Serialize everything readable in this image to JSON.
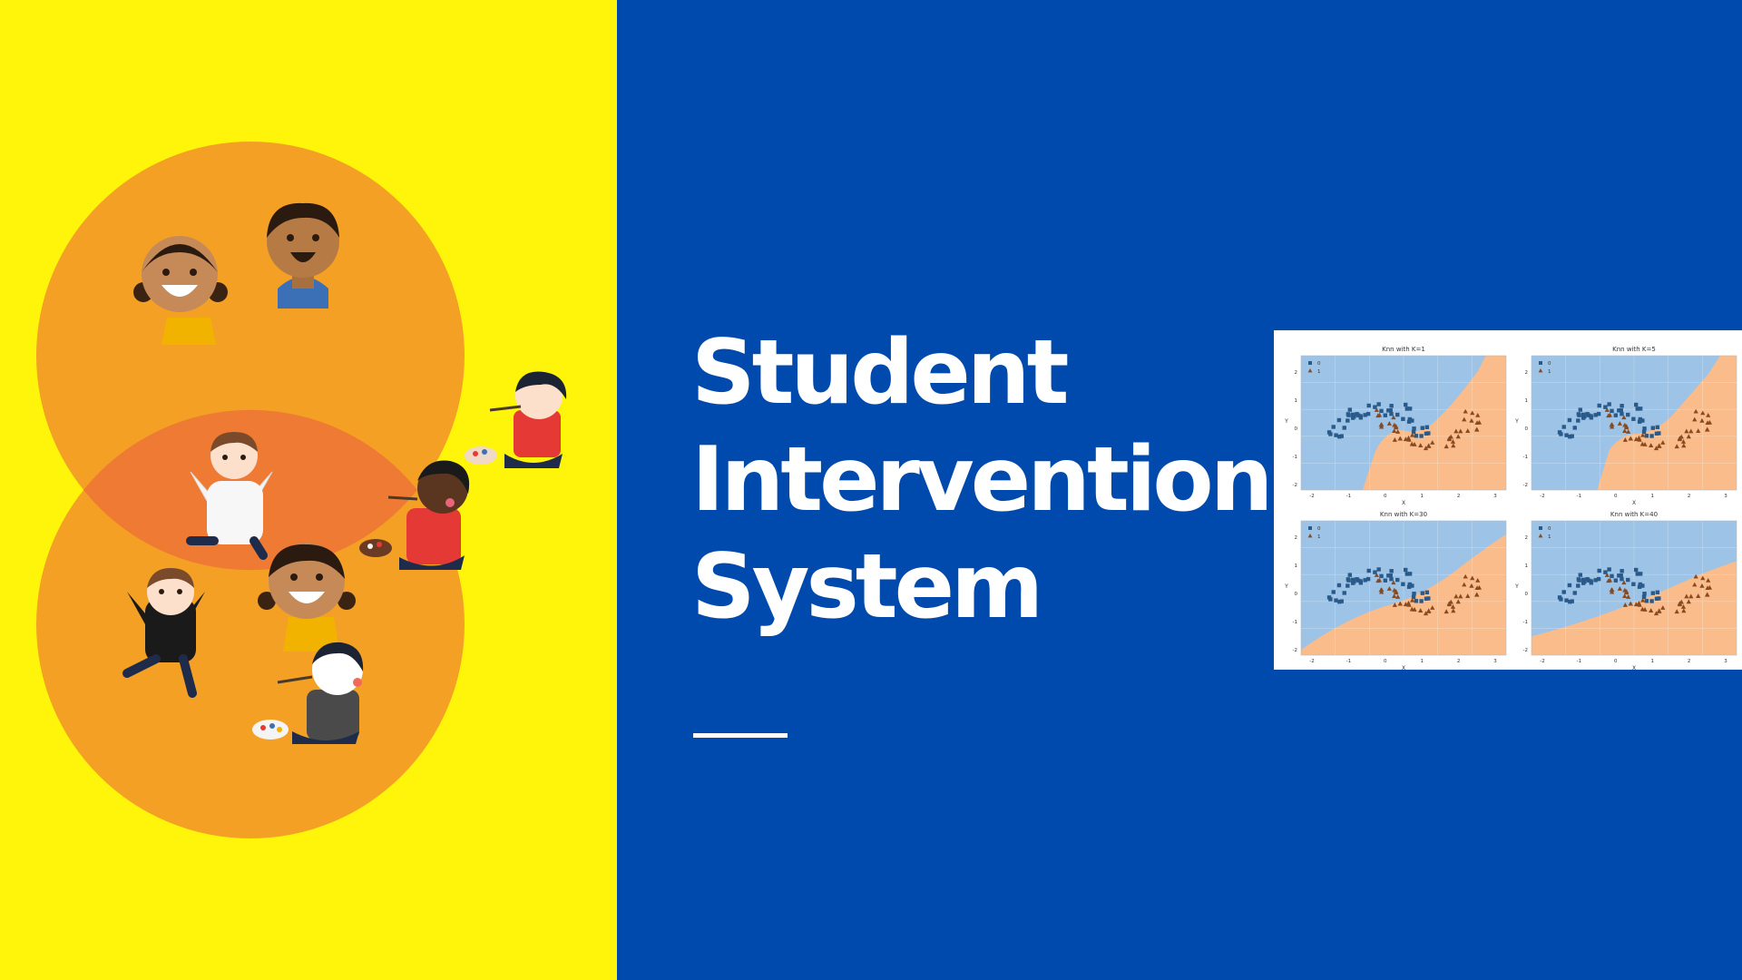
{
  "slide": {
    "title_lines": [
      "Student",
      "Intervention",
      "System"
    ],
    "colors": {
      "left_bg": "#fff50a",
      "right_bg": "#004aad",
      "circle": "#f4a025",
      "overlap": "#ef7a33",
      "title": "#ffffff"
    }
  },
  "illustration": {
    "icons": [
      "girl-face-icon",
      "boy-face-icon",
      "painting-boy-icon",
      "jumping-girl-icon",
      "painting-kid-icon",
      "jumping-girl-dark-icon",
      "smiling-kid-icon",
      "painting-kid-gray-icon"
    ]
  },
  "knn_figure": {
    "panels": [
      {
        "title": "Knn with K=1"
      },
      {
        "title": "Knn with K=5"
      },
      {
        "title": "Knn with K=30"
      },
      {
        "title": "Knn with K=40"
      }
    ],
    "xlabel": "X",
    "ylabel": "Y",
    "legend": [
      "0",
      "1"
    ],
    "x_ticks": [
      "-2",
      "-1",
      "0",
      "1",
      "2",
      "3"
    ],
    "y_ticks": [
      "2",
      "1",
      "0",
      "-1",
      "-2"
    ],
    "colors": {
      "class0_region": "#9dc3e6",
      "class1_region": "#f9bc8a",
      "class0_marker": "#2a5a8a",
      "class1_marker": "#8a4a20"
    }
  }
}
